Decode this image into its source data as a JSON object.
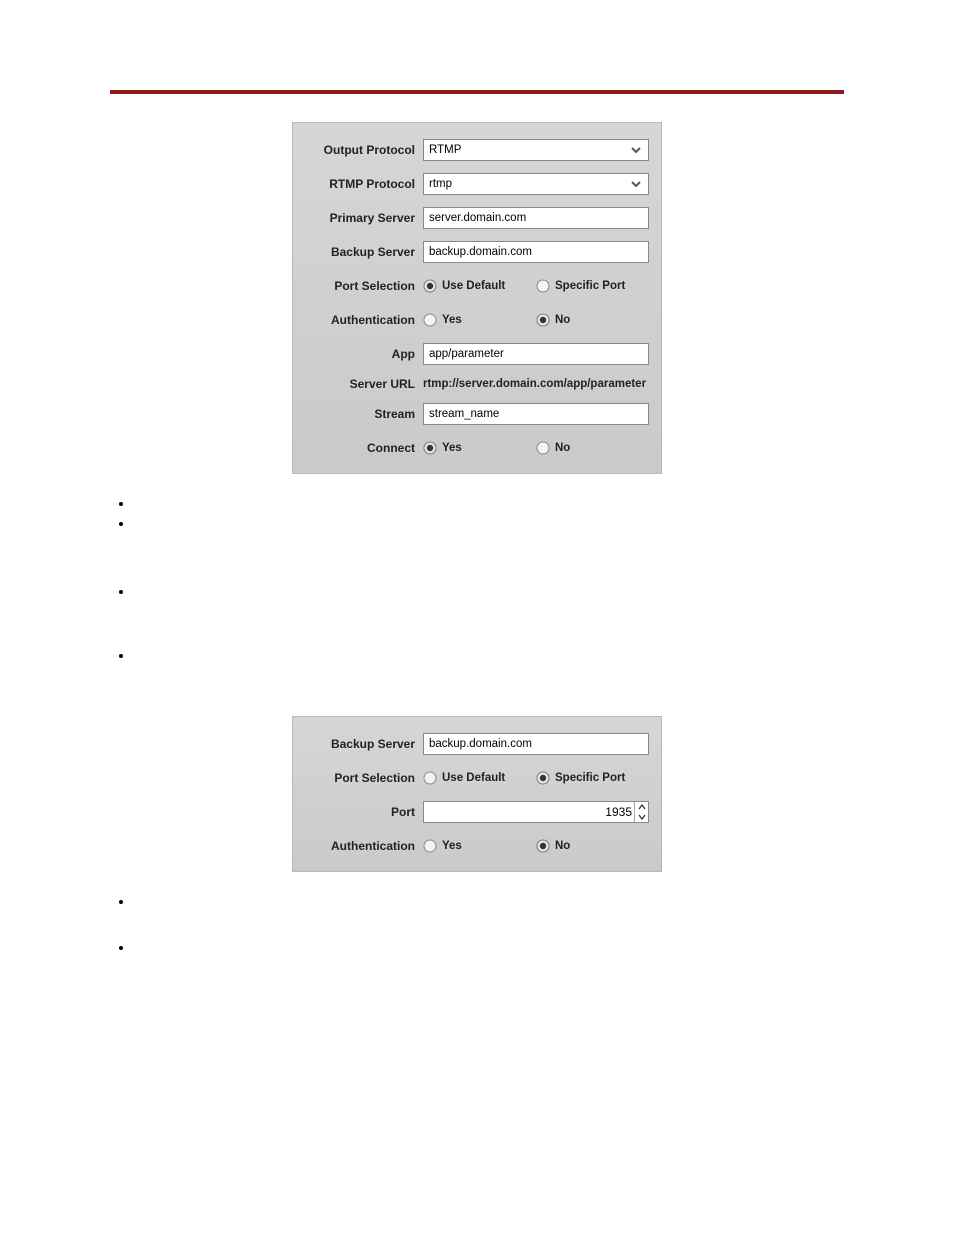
{
  "panel1": {
    "rows": {
      "outputProtocol": {
        "label": "Output Protocol",
        "value": "RTMP"
      },
      "rtmpProtocol": {
        "label": "RTMP Protocol",
        "value": "rtmp"
      },
      "primaryServer": {
        "label": "Primary Server",
        "value": "server.domain.com"
      },
      "backupServer": {
        "label": "Backup Server",
        "value": "backup.domain.com"
      },
      "portSelection": {
        "label": "Port Selection",
        "opt1": "Use Default",
        "opt2": "Specific Port",
        "selected": 1
      },
      "authentication": {
        "label": "Authentication",
        "opt1": "Yes",
        "opt2": "No",
        "selected": 2
      },
      "app": {
        "label": "App",
        "value": "app/parameter"
      },
      "serverUrl": {
        "label": "Server URL",
        "value": "rtmp://server.domain.com/app/parameter"
      },
      "stream": {
        "label": "Stream",
        "value": "stream_name"
      },
      "connect": {
        "label": "Connect",
        "opt1": "Yes",
        "opt2": "No",
        "selected": 1
      }
    }
  },
  "bullets1": [
    "",
    "",
    "",
    ""
  ],
  "panel2": {
    "rows": {
      "backupServer": {
        "label": "Backup Server",
        "value": "backup.domain.com"
      },
      "portSelection": {
        "label": "Port Selection",
        "opt1": "Use Default",
        "opt2": "Specific Port",
        "selected": 2
      },
      "port": {
        "label": "Port",
        "value": "1935"
      },
      "authentication": {
        "label": "Authentication",
        "opt1": "Yes",
        "opt2": "No",
        "selected": 2
      }
    }
  },
  "bullets2": [
    "",
    ""
  ]
}
